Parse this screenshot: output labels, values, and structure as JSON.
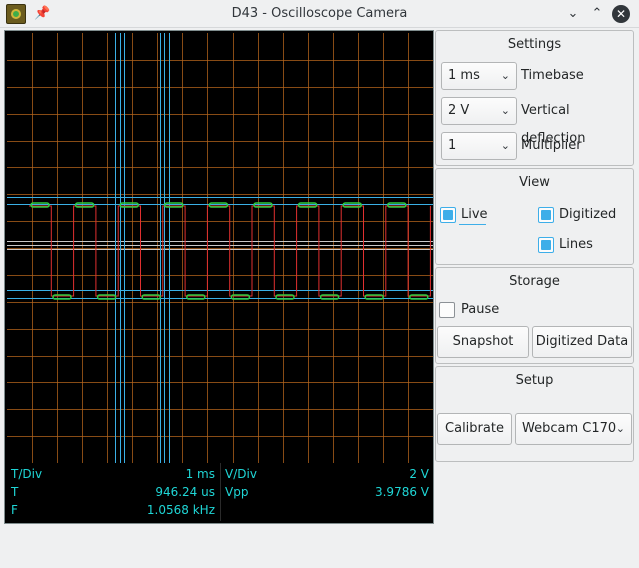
{
  "window": {
    "title": "D43 - Oscilloscope Camera",
    "minimize_glyph": "⌄",
    "maximize_glyph": "⌃",
    "close_glyph": "✕",
    "pin_glyph": "📌"
  },
  "scope": {
    "colors": {
      "background": "#000000",
      "grid": "#b5651d",
      "cursor": "#3ab0e6",
      "trace": "#e03030",
      "digitized": "#2ecc40"
    },
    "readout": {
      "tdiv_label": "T/Div",
      "tdiv_value": "1 ms",
      "vdiv_label": "V/Div",
      "vdiv_value": "2 V",
      "t_label": "T",
      "t_value": "946.24 us",
      "vpp_label": "Vpp",
      "vpp_value": "3.9786 V",
      "f_label": "F",
      "f_value": "1.0568 kHz"
    }
  },
  "settings": {
    "title": "Settings",
    "timebase_value": "1 ms",
    "timebase_label": "Timebase",
    "vdef_value": "2 V",
    "vdef_label": "Vertical deflection",
    "multiplier_value": "1",
    "multiplier_label": "Multiplier"
  },
  "view": {
    "title": "View",
    "live_label": "Live",
    "live_checked": true,
    "digitized_label": "Digitized",
    "digitized_checked": true,
    "lines_label": "Lines",
    "lines_checked": true
  },
  "storage": {
    "title": "Storage",
    "pause_label": "Pause",
    "pause_checked": false,
    "snapshot_label": "Snapshot",
    "digitized_data_label": "Digitized Data"
  },
  "setup": {
    "title": "Setup",
    "calibrate_label": "Calibrate",
    "camera_value": "Webcam C170"
  }
}
